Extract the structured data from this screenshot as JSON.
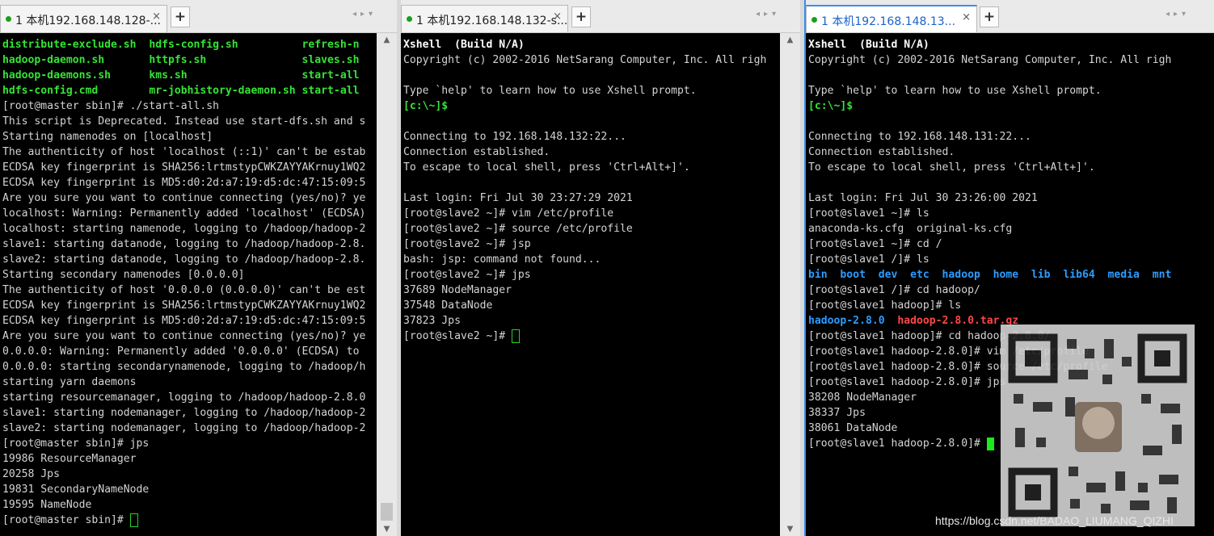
{
  "panes": [
    {
      "tab_label": "1 本机192.168.148.128-...",
      "close_symbol": "×",
      "add_symbol": "+",
      "lines": [
        [
          {
            "t": "distribute-exclude.sh  ",
            "c": "g"
          },
          {
            "t": "hdfs-config.sh          ",
            "c": "g"
          },
          {
            "t": "refresh-n",
            "c": "g"
          }
        ],
        [
          {
            "t": "hadoop-daemon.sh       ",
            "c": "g"
          },
          {
            "t": "httpfs.sh               ",
            "c": "g"
          },
          {
            "t": "slaves.sh",
            "c": "g"
          }
        ],
        [
          {
            "t": "hadoop-daemons.sh      ",
            "c": "g"
          },
          {
            "t": "kms.sh                  ",
            "c": "g"
          },
          {
            "t": "start-all",
            "c": "g"
          }
        ],
        [
          {
            "t": "hdfs-config.cmd        ",
            "c": "g"
          },
          {
            "t": "mr-jobhistory-daemon.sh ",
            "c": "g"
          },
          {
            "t": "start-all",
            "c": "g"
          }
        ],
        [
          {
            "t": "[root@master sbin]# ./start-all.sh"
          }
        ],
        [
          {
            "t": "This script is Deprecated. Instead use start-dfs.sh and s"
          }
        ],
        [
          {
            "t": "Starting namenodes on [localhost]"
          }
        ],
        [
          {
            "t": "The authenticity of host 'localhost (::1)' can't be estab"
          }
        ],
        [
          {
            "t": "ECDSA key fingerprint is SHA256:lrtmstypCWKZAYYAKrnuy1WQ2"
          }
        ],
        [
          {
            "t": "ECDSA key fingerprint is MD5:d0:2d:a7:19:d5:dc:47:15:09:5"
          }
        ],
        [
          {
            "t": "Are you sure you want to continue connecting (yes/no)? ye"
          }
        ],
        [
          {
            "t": "localhost: Warning: Permanently added 'localhost' (ECDSA)"
          }
        ],
        [
          {
            "t": "localhost: starting namenode, logging to /hadoop/hadoop-2"
          }
        ],
        [
          {
            "t": "slave1: starting datanode, logging to /hadoop/hadoop-2.8."
          }
        ],
        [
          {
            "t": "slave2: starting datanode, logging to /hadoop/hadoop-2.8."
          }
        ],
        [
          {
            "t": "Starting secondary namenodes [0.0.0.0]"
          }
        ],
        [
          {
            "t": "The authenticity of host '0.0.0.0 (0.0.0.0)' can't be est"
          }
        ],
        [
          {
            "t": "ECDSA key fingerprint is SHA256:lrtmstypCWKZAYYAKrnuy1WQ2"
          }
        ],
        [
          {
            "t": "ECDSA key fingerprint is MD5:d0:2d:a7:19:d5:dc:47:15:09:5"
          }
        ],
        [
          {
            "t": "Are you sure you want to continue connecting (yes/no)? ye"
          }
        ],
        [
          {
            "t": "0.0.0.0: Warning: Permanently added '0.0.0.0' (ECDSA) to "
          }
        ],
        [
          {
            "t": "0.0.0.0: starting secondarynamenode, logging to /hadoop/h"
          }
        ],
        [
          {
            "t": "starting yarn daemons"
          }
        ],
        [
          {
            "t": "starting resourcemanager, logging to /hadoop/hadoop-2.8.0"
          }
        ],
        [
          {
            "t": "slave1: starting nodemanager, logging to /hadoop/hadoop-2"
          }
        ],
        [
          {
            "t": "slave2: starting nodemanager, logging to /hadoop/hadoop-2"
          }
        ],
        [
          {
            "t": "[root@master sbin]# jps"
          }
        ],
        [
          {
            "t": "19986 ResourceManager"
          }
        ],
        [
          {
            "t": "20258 Jps"
          }
        ],
        [
          {
            "t": "19831 SecondaryNameNode"
          }
        ],
        [
          {
            "t": "19595 NameNode"
          }
        ],
        [
          {
            "t": "[root@master sbin]# "
          },
          {
            "cursor": "outline"
          }
        ]
      ]
    },
    {
      "tab_label": "1 本机192.168.148.132-s...",
      "close_symbol": "×",
      "add_symbol": "+",
      "lines": [
        [
          {
            "t": "Xshell  (Build N/A)",
            "c": "bright"
          }
        ],
        [
          {
            "t": "Copyright (c) 2002-2016 NetSarang Computer, Inc. All righ"
          }
        ],
        [
          {
            "t": ""
          }
        ],
        [
          {
            "t": "Type `help' to learn how to use Xshell prompt."
          }
        ],
        [
          {
            "t": "[c:\\~]$",
            "c": "g"
          }
        ],
        [
          {
            "t": ""
          }
        ],
        [
          {
            "t": "Connecting to 192.168.148.132:22..."
          }
        ],
        [
          {
            "t": "Connection established."
          }
        ],
        [
          {
            "t": "To escape to local shell, press 'Ctrl+Alt+]'."
          }
        ],
        [
          {
            "t": ""
          }
        ],
        [
          {
            "t": "Last login: Fri Jul 30 23:27:29 2021"
          }
        ],
        [
          {
            "t": "[root@slave2 ~]# vim /etc/profile"
          }
        ],
        [
          {
            "t": "[root@slave2 ~]# source /etc/profile"
          }
        ],
        [
          {
            "t": "[root@slave2 ~]# jsp"
          }
        ],
        [
          {
            "t": "bash: jsp: command not found..."
          }
        ],
        [
          {
            "t": "[root@slave2 ~]# jps"
          }
        ],
        [
          {
            "t": "37689 NodeManager"
          }
        ],
        [
          {
            "t": "37548 DataNode"
          }
        ],
        [
          {
            "t": "37823 Jps"
          }
        ],
        [
          {
            "t": "[root@slave2 ~]# "
          },
          {
            "cursor": "outline"
          }
        ]
      ]
    },
    {
      "tab_label": "1 本机192.168.148.13...",
      "close_symbol": "×",
      "add_symbol": "+",
      "lines": [
        [
          {
            "t": "Xshell  (Build N/A)",
            "c": "bright"
          }
        ],
        [
          {
            "t": "Copyright (c) 2002-2016 NetSarang Computer, Inc. All righ"
          }
        ],
        [
          {
            "t": ""
          }
        ],
        [
          {
            "t": "Type `help' to learn how to use Xshell prompt."
          }
        ],
        [
          {
            "t": "[c:\\~]$",
            "c": "g"
          }
        ],
        [
          {
            "t": ""
          }
        ],
        [
          {
            "t": "Connecting to 192.168.148.131:22..."
          }
        ],
        [
          {
            "t": "Connection established."
          }
        ],
        [
          {
            "t": "To escape to local shell, press 'Ctrl+Alt+]'."
          }
        ],
        [
          {
            "t": ""
          }
        ],
        [
          {
            "t": "Last login: Fri Jul 30 23:26:00 2021"
          }
        ],
        [
          {
            "t": "[root@slave1 ~]# ls"
          }
        ],
        [
          {
            "t": "anaconda-ks.cfg  original-ks.cfg"
          }
        ],
        [
          {
            "t": "[root@slave1 ~]# cd /"
          }
        ],
        [
          {
            "t": "[root@slave1 /]# ls"
          }
        ],
        [
          {
            "t": "bin  boot  dev  etc  hadoop  home  lib  lib64  media  mnt",
            "c": "b"
          }
        ],
        [
          {
            "t": "[root@slave1 /]# cd hadoop/"
          }
        ],
        [
          {
            "t": "[root@slave1 hadoop]# ls"
          }
        ],
        [
          {
            "t": "hadoop-2.8.0  ",
            "c": "b"
          },
          {
            "t": "hadoop-2.8.0.tar.gz",
            "c": "r"
          }
        ],
        [
          {
            "t": "[root@slave1 hadoop]# cd hadoop-2.8.0/"
          }
        ],
        [
          {
            "t": "[root@slave1 hadoop-2.8.0]# vim /etc/profile"
          }
        ],
        [
          {
            "t": "[root@slave1 hadoop-2.8.0]# source /etc/profile"
          }
        ],
        [
          {
            "t": "[root@slave1 hadoop-2.8.0]# jps"
          }
        ],
        [
          {
            "t": "38208 NodeManager"
          }
        ],
        [
          {
            "t": "38337 Jps"
          }
        ],
        [
          {
            "t": "38061 DataNode"
          }
        ],
        [
          {
            "t": "[root@slave1 hadoop-2.8.0]# "
          },
          {
            "cursor": "solid"
          }
        ]
      ]
    }
  ],
  "watermark": "https://blog.csdn.net/BADAO_LIUMANG_QIZHI",
  "colors": {
    "prompt_green": "#35e335",
    "dir_blue": "#2c9cff",
    "archive_red": "#ff4545",
    "active_tab": "#3b8ee8",
    "terminal_bg": "#000000"
  }
}
